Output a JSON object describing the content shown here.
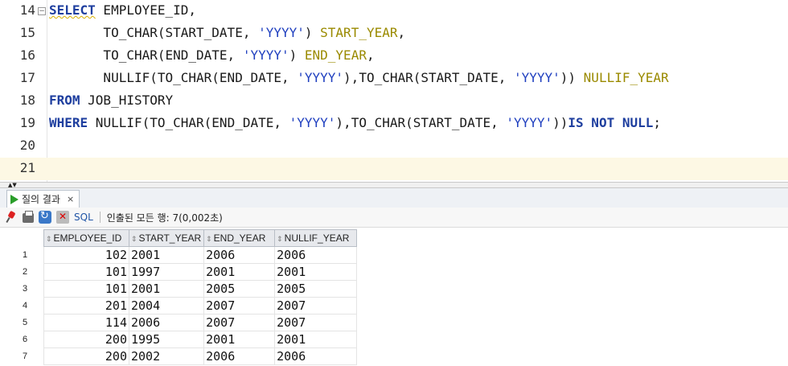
{
  "editor": {
    "lines": [
      {
        "num": "14",
        "tokens": [
          [
            "kw",
            "SELECT"
          ],
          [
            "plain",
            " EMPLOYEE_ID,"
          ]
        ]
      },
      {
        "num": "15",
        "tokens": [
          [
            "plain",
            "       TO_CHAR(START_DATE, "
          ],
          [
            "str",
            "'YYYY'"
          ],
          [
            "plain",
            ") "
          ],
          [
            "alias",
            "START_YEAR"
          ],
          [
            "plain",
            ","
          ]
        ]
      },
      {
        "num": "16",
        "tokens": [
          [
            "plain",
            "       TO_CHAR(END_DATE, "
          ],
          [
            "str",
            "'YYYY'"
          ],
          [
            "plain",
            ") "
          ],
          [
            "alias",
            "END_YEAR"
          ],
          [
            "plain",
            ","
          ]
        ]
      },
      {
        "num": "17",
        "tokens": [
          [
            "plain",
            "       NULLIF(TO_CHAR(END_DATE, "
          ],
          [
            "str",
            "'YYYY'"
          ],
          [
            "plain",
            "),TO_CHAR(START_DATE, "
          ],
          [
            "str",
            "'YYYY'"
          ],
          [
            "plain",
            ")) "
          ],
          [
            "alias",
            "NULLIF_YEAR"
          ]
        ]
      },
      {
        "num": "18",
        "tokens": [
          [
            "kw",
            "FROM"
          ],
          [
            "plain",
            " JOB_HISTORY"
          ]
        ]
      },
      {
        "num": "19",
        "tokens": [
          [
            "kw",
            "WHERE"
          ],
          [
            "plain",
            " NULLIF(TO_CHAR(END_DATE, "
          ],
          [
            "str",
            "'YYYY'"
          ],
          [
            "plain",
            "),TO_CHAR(START_DATE, "
          ],
          [
            "str",
            "'YYYY'"
          ],
          [
            "plain",
            "))"
          ],
          [
            "kw",
            "IS NOT NULL"
          ],
          [
            "plain",
            ";"
          ]
        ]
      },
      {
        "num": "20",
        "tokens": []
      },
      {
        "num": "21",
        "tokens": []
      }
    ]
  },
  "results": {
    "tab_label": "질의 결과",
    "tab_close": "×",
    "toolbar_sql": "SQL",
    "status": "인출된 모든 행: 7(0,002초)",
    "columns": [
      "EMPLOYEE_ID",
      "START_YEAR",
      "END_YEAR",
      "NULLIF_YEAR"
    ],
    "rows": [
      [
        "1",
        "102",
        "2001",
        "2006",
        "2006"
      ],
      [
        "2",
        "101",
        "1997",
        "2001",
        "2001"
      ],
      [
        "3",
        "101",
        "2001",
        "2005",
        "2005"
      ],
      [
        "4",
        "201",
        "2004",
        "2007",
        "2007"
      ],
      [
        "5",
        "114",
        "2006",
        "2007",
        "2007"
      ],
      [
        "6",
        "200",
        "1995",
        "2001",
        "2001"
      ],
      [
        "7",
        "200",
        "2002",
        "2006",
        "2006"
      ]
    ]
  }
}
